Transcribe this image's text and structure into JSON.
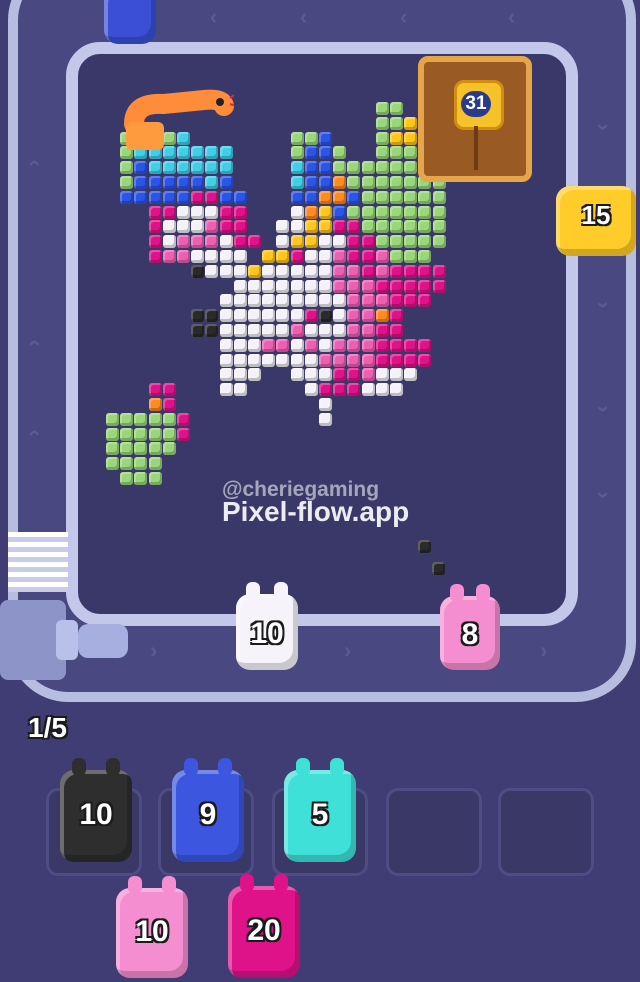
{
  "game": {
    "watermark": "@cheriegaming",
    "app_name": "Pixel-flow.app",
    "level_counter": "1/5",
    "chest_count": "31",
    "colors": {
      "background": "#3f3d73",
      "track": "#c3c8ea",
      "white": "#f4f2f8",
      "pink": "#ee5fb2",
      "magenta": "#e0128a",
      "green": "#9ad67a",
      "blue": "#2b55e8",
      "cyan": "#3fd0e8",
      "yellow": "#ffc71e",
      "orange": "#ff8a1e",
      "black": "#2a2a2a"
    },
    "conveyor_shooters": [
      {
        "name": "blue-shooter-top",
        "color": "#3a4fd6",
        "count": ""
      },
      {
        "name": "yellow-shooter-right",
        "color": "#ffcc2a",
        "count": "15"
      },
      {
        "name": "white-shooter-belt",
        "color": "#f6f4fa",
        "count": "10"
      },
      {
        "name": "pink-shooter-belt",
        "color": "#f58ed0",
        "count": "8"
      }
    ],
    "queue_slots": [
      {
        "color": "#2e2e2e",
        "count": "10"
      },
      {
        "color": "#3c56e0",
        "count": "9"
      },
      {
        "color": "#3fe0d8",
        "count": "5"
      },
      {
        "color": "",
        "count": ""
      },
      {
        "color": "",
        "count": ""
      }
    ],
    "reserve_pigs": [
      {
        "color": "#f58ed0",
        "count": "10"
      },
      {
        "color": "#e0128a",
        "count": "20"
      }
    ]
  }
}
